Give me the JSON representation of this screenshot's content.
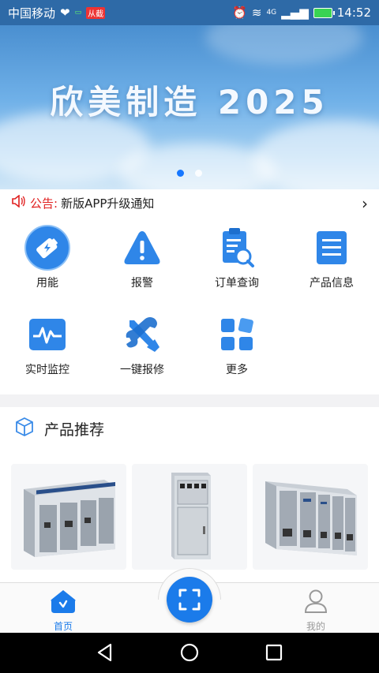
{
  "status_bar": {
    "carrier": "中国移动",
    "tiny_badge": "从截",
    "network": "4G",
    "time": "14:52"
  },
  "banner": {
    "title": "欣美制造 2025",
    "slides": 2,
    "active_slide": 1
  },
  "notice": {
    "label": "公告:",
    "text": "新版APP升级通知"
  },
  "menu": {
    "items": [
      {
        "label": "用能",
        "icon": "energy-icon"
      },
      {
        "label": "报警",
        "icon": "alarm-icon"
      },
      {
        "label": "订单查询",
        "icon": "order-search-icon"
      },
      {
        "label": "产品信息",
        "icon": "product-info-icon"
      },
      {
        "label": "实时监控",
        "icon": "monitor-icon"
      },
      {
        "label": "一键报修",
        "icon": "repair-icon"
      },
      {
        "label": "更多",
        "icon": "more-icon"
      }
    ]
  },
  "products": {
    "title": "产品推荐",
    "icon": "box-icon",
    "items": [
      {
        "name": "switchgear-1"
      },
      {
        "name": "switchgear-2"
      },
      {
        "name": "switchgear-3"
      }
    ]
  },
  "tabbar": {
    "home_label": "首页",
    "mine_label": "我的",
    "scan_icon": "scan-icon",
    "active_color": "#1b7bea",
    "inactive_color": "#999999"
  },
  "colors": {
    "brand_blue": "#1b7bea",
    "notice_red": "#e02020"
  }
}
